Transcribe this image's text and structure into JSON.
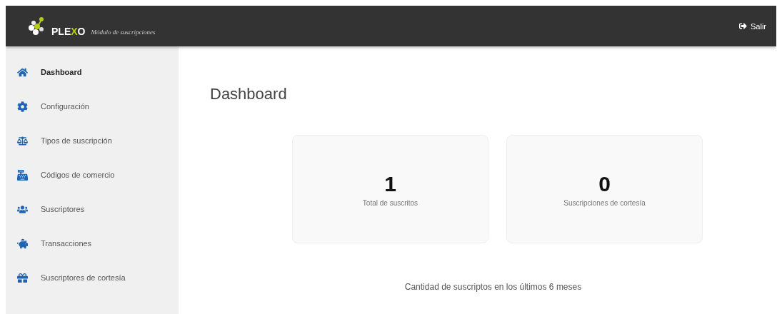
{
  "header": {
    "brand": "PLEXO",
    "subtitle": "Módulo de suscripciones",
    "logout": "Salir"
  },
  "sidebar": {
    "items": [
      {
        "kind": "home",
        "label": "Dashboard",
        "selected": true
      },
      {
        "kind": "gear",
        "label": "Configuración",
        "selected": false
      },
      {
        "kind": "scale",
        "label": "Tipos de suscripción",
        "selected": false
      },
      {
        "kind": "register",
        "label": "Códigos de comercio",
        "selected": false
      },
      {
        "kind": "users",
        "label": "Suscriptores",
        "selected": false
      },
      {
        "kind": "piggy",
        "label": "Transacciones",
        "selected": false
      },
      {
        "kind": "gift",
        "label": "Suscriptores de cortesía",
        "selected": false
      }
    ]
  },
  "page": {
    "title": "Dashboard",
    "stats": [
      {
        "value": "1",
        "label": "Total de suscritos"
      },
      {
        "value": "0",
        "label": "Suscripciones de cortesía"
      }
    ],
    "chart_caption": "Cantidad de suscriptos en los últimos 6 meses"
  }
}
